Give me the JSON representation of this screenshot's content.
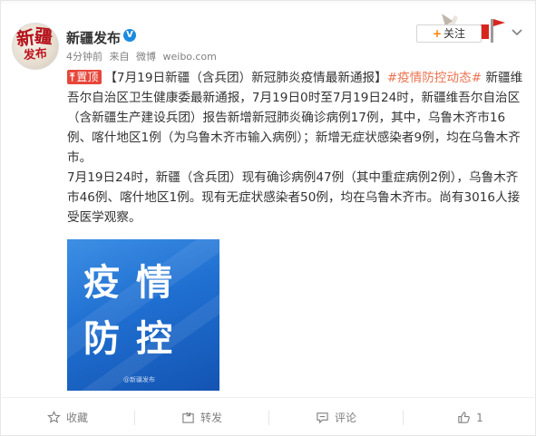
{
  "header": {
    "username": "新疆发布",
    "verified_mark": "V",
    "time": "4分钟前",
    "source_prefix": "来自",
    "source": "微博",
    "site": "weibo.com",
    "follow_label": "关注",
    "follow_plus": "+"
  },
  "avatar": {
    "text1": "新",
    "text2": "疆",
    "text3": "发布"
  },
  "post": {
    "pin_label": "置顶",
    "pin_arrow": "⤒",
    "headline": "【7月19日新疆（含兵团）新冠肺炎疫情最新通报】",
    "topic": "#疫情防控动态#",
    "para1_rest": " 新疆维吾尔自治区卫生健康委最新通报，7月19日0时至7月19日24时，新疆维吾尔自治区（含新疆生产建设兵团）报告新增新冠肺炎确诊病例17例，其中，乌鲁木齐市16例、喀什地区1例（为乌鲁木齐市输入病例）；新增无症状感染者9例，均在乌鲁木齐市。",
    "para2": "7月19日24时，新疆（含兵团）现有确诊病例47例（其中重症病例2例），乌鲁木齐市46例、喀什地区1例。现有无症状感染者50例，均在乌鲁木齐市。尚有3016人接受医学观察。"
  },
  "image": {
    "row1": "疫情",
    "row2": "防控",
    "watermark": "@新疆发布"
  },
  "footer": {
    "favorite": "收藏",
    "repost": "转发",
    "comment": "评论",
    "like_count": "1"
  },
  "colors": {
    "topic": "#eb7350",
    "pin_bg": "#e7473b",
    "follow_plus": "#ff8200",
    "verified": "#1b8be0",
    "image_blue": "#1f6fd1"
  }
}
